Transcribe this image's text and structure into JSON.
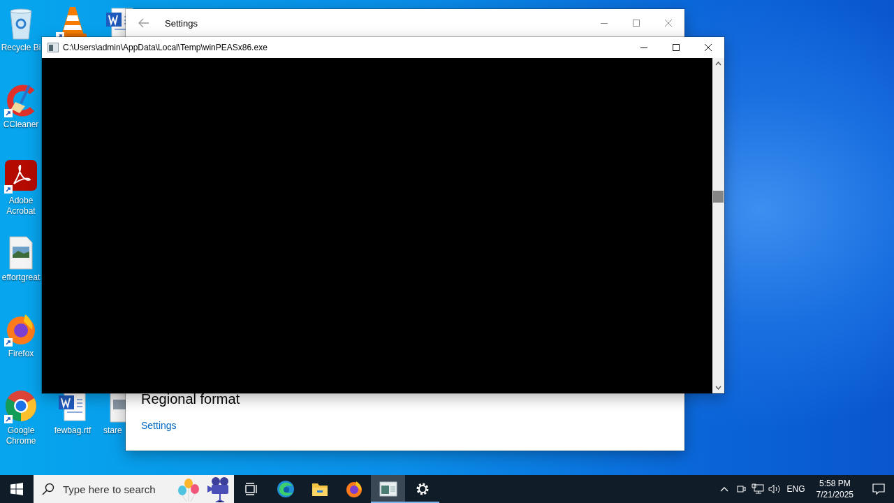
{
  "desktop": {
    "columns": [
      [
        {
          "kind": "recycle-bin",
          "label": "Recycle Bi",
          "shortcut": false
        },
        {
          "kind": "brush",
          "label": "CCleaner",
          "shortcut": true
        },
        {
          "kind": "pdf",
          "label": "Adobe Acrobat",
          "shortcut": true
        },
        {
          "kind": "image-file",
          "label": "effortgreat",
          "shortcut": false
        },
        {
          "kind": "firefox",
          "label": "Firefox",
          "shortcut": true
        },
        {
          "kind": "chrome",
          "label": "Google Chrome",
          "shortcut": true
        }
      ],
      [
        {
          "kind": "cone",
          "shortcut": true
        },
        {
          "kind": "word-doc",
          "label": "fewbag.rtf",
          "shortcut": false
        }
      ],
      [
        {
          "kind": "word-doc",
          "shortcut": false
        },
        {
          "kind": "file",
          "label": "stare",
          "shortcut": false
        }
      ]
    ]
  },
  "settings_window": {
    "title": "Settings",
    "heading": "Regional format",
    "link": "Settings"
  },
  "console_window": {
    "title": "C:\\Users\\admin\\AppData\\Local\\Temp\\winPEASx86.exe"
  },
  "taskbar": {
    "search": {
      "placeholder": "Type here to search"
    },
    "apps": [
      {
        "kind": "task-view",
        "running": false,
        "selected": false
      },
      {
        "kind": "edge",
        "running": false,
        "selected": false
      },
      {
        "kind": "folder",
        "running": false,
        "selected": false
      },
      {
        "kind": "firefox",
        "running": false,
        "selected": false
      },
      {
        "kind": "console",
        "running": true,
        "selected": true
      },
      {
        "kind": "gear",
        "running": true,
        "selected": false
      }
    ],
    "tray": {
      "language": "ENG",
      "time": "5:58 PM",
      "date": "7/21/2025"
    }
  }
}
